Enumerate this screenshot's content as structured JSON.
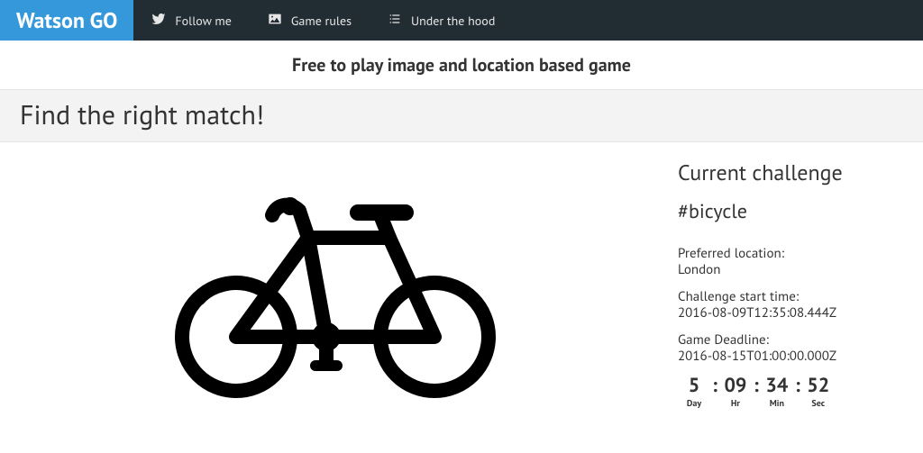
{
  "nav": {
    "brand": "Watson GO",
    "links": [
      {
        "icon": "twitter",
        "label": "Follow me"
      },
      {
        "icon": "image",
        "label": "Game rules"
      },
      {
        "icon": "list",
        "label": "Under the hood"
      }
    ]
  },
  "tagline": "Free to play image and location based game",
  "page_title": "Find the right match!",
  "image": {
    "name": "bicycle-image"
  },
  "sidebar": {
    "heading": "Current challenge",
    "tag": "#bicycle",
    "location_label": "Preferred location:",
    "location_value": "London",
    "start_label": "Challenge start time:",
    "start_value": "2016-08-09T12:35:08.444Z",
    "deadline_label": "Game Deadline:",
    "deadline_value": "2016-08-15T01:00:00.000Z",
    "countdown": {
      "day": {
        "value": "5",
        "label": "Day"
      },
      "hr": {
        "value": "09",
        "label": "Hr"
      },
      "min": {
        "value": "34",
        "label": "Min"
      },
      "sec": {
        "value": "52",
        "label": "Sec"
      },
      "sep": ":"
    }
  }
}
